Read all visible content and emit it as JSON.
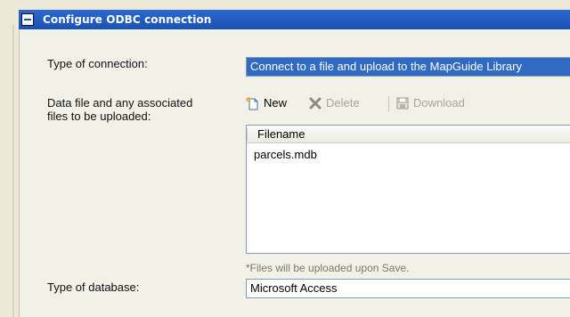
{
  "section": {
    "title": "Configure ODBC connection",
    "icon": "collapse-icon"
  },
  "connection_type": {
    "label": "Type of connection:",
    "value": "Connect to a file and upload to the MapGuide Library"
  },
  "files": {
    "label_line1": "Data file and any associated",
    "label_line2": "files to be uploaded:",
    "toolbar": {
      "new_label": "New",
      "delete_label": "Delete",
      "download_label": "Download"
    },
    "grid": {
      "columns": [
        "Filename"
      ],
      "rows": [
        {
          "filename": "parcels.mdb"
        }
      ]
    },
    "note": "*Files will be uploaded upon Save."
  },
  "database_type": {
    "label": "Type of database:",
    "value": "Microsoft Access"
  },
  "colors": {
    "header": "#1b52b4",
    "selection": "#316ac5",
    "disabled": "#a7a7a0"
  }
}
